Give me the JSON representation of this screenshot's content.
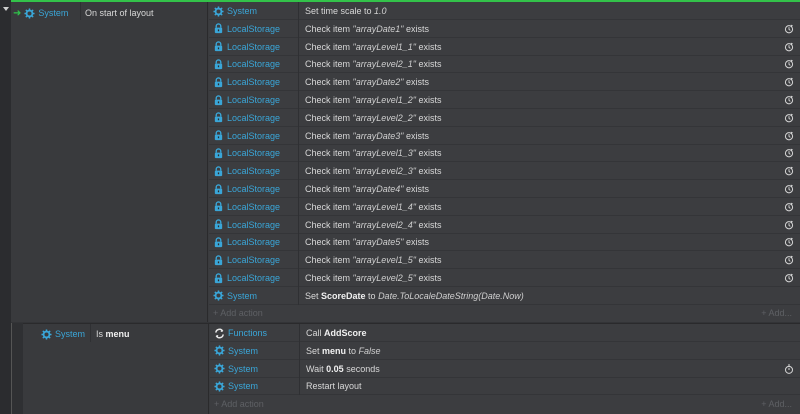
{
  "colors": {
    "link": "#3aa6d8",
    "start_green": "#33c24a",
    "bg": "#333437"
  },
  "event1": {
    "trigger_icon": "arrow-right-icon",
    "condition": {
      "object": "System",
      "object_icon": "gear-icon",
      "text": "On start of layout"
    },
    "actions": [
      {
        "object": "System",
        "icon": "gear-icon",
        "parts": [
          "Set time scale to ",
          {
            "i": "1.0"
          }
        ]
      },
      {
        "object": "LocalStorage",
        "icon": "lock-icon",
        "parts": [
          "Check item ",
          {
            "i": "\"arrayDate1\""
          },
          " exists"
        ],
        "async": true
      },
      {
        "object": "LocalStorage",
        "icon": "lock-icon",
        "parts": [
          "Check item ",
          {
            "i": "\"arrayLevel1_1\""
          },
          " exists"
        ],
        "async": true
      },
      {
        "object": "LocalStorage",
        "icon": "lock-icon",
        "parts": [
          "Check item ",
          {
            "i": "\"arrayLevel2_1\""
          },
          " exists"
        ],
        "async": true
      },
      {
        "object": "LocalStorage",
        "icon": "lock-icon",
        "parts": [
          "Check item ",
          {
            "i": "\"arrayDate2\""
          },
          " exists"
        ],
        "async": true
      },
      {
        "object": "LocalStorage",
        "icon": "lock-icon",
        "parts": [
          "Check item ",
          {
            "i": "\"arrayLevel1_2\""
          },
          " exists"
        ],
        "async": true
      },
      {
        "object": "LocalStorage",
        "icon": "lock-icon",
        "parts": [
          "Check item ",
          {
            "i": "\"arrayLevel2_2\""
          },
          " exists"
        ],
        "async": true
      },
      {
        "object": "LocalStorage",
        "icon": "lock-icon",
        "parts": [
          "Check item ",
          {
            "i": "\"arrayDate3\""
          },
          " exists"
        ],
        "async": true
      },
      {
        "object": "LocalStorage",
        "icon": "lock-icon",
        "parts": [
          "Check item ",
          {
            "i": "\"arrayLevel1_3\""
          },
          " exists"
        ],
        "async": true
      },
      {
        "object": "LocalStorage",
        "icon": "lock-icon",
        "parts": [
          "Check item ",
          {
            "i": "\"arrayLevel2_3\""
          },
          " exists"
        ],
        "async": true
      },
      {
        "object": "LocalStorage",
        "icon": "lock-icon",
        "parts": [
          "Check item ",
          {
            "i": "\"arrayDate4\""
          },
          " exists"
        ],
        "async": true
      },
      {
        "object": "LocalStorage",
        "icon": "lock-icon",
        "parts": [
          "Check item ",
          {
            "i": "\"arrayLevel1_4\""
          },
          " exists"
        ],
        "async": true
      },
      {
        "object": "LocalStorage",
        "icon": "lock-icon",
        "parts": [
          "Check item ",
          {
            "i": "\"arrayLevel2_4\""
          },
          " exists"
        ],
        "async": true
      },
      {
        "object": "LocalStorage",
        "icon": "lock-icon",
        "parts": [
          "Check item ",
          {
            "i": "\"arrayDate5\""
          },
          " exists"
        ],
        "async": true
      },
      {
        "object": "LocalStorage",
        "icon": "lock-icon",
        "parts": [
          "Check item ",
          {
            "i": "\"arrayLevel1_5\""
          },
          " exists"
        ],
        "async": true
      },
      {
        "object": "LocalStorage",
        "icon": "lock-icon",
        "parts": [
          "Check item ",
          {
            "i": "\"arrayLevel2_5\""
          },
          " exists"
        ],
        "async": true
      },
      {
        "object": "System",
        "icon": "gear-icon",
        "parts": [
          "Set ",
          {
            "b": "ScoreDate"
          },
          " to ",
          {
            "i": "Date.ToLocaleDateString(Date.Now)"
          }
        ]
      }
    ],
    "add_action_left": "+ Add action",
    "add_action_right": "+ Add..."
  },
  "event2": {
    "condition": {
      "object": "System",
      "object_icon": "gear-icon",
      "text_prefix": "Is ",
      "text_bold": "menu"
    },
    "actions": [
      {
        "object": "Functions",
        "icon": "functions-icon",
        "parts": [
          "Call ",
          {
            "b": "AddScore"
          }
        ]
      },
      {
        "object": "System",
        "icon": "gear-icon",
        "parts": [
          "Set ",
          {
            "b": "menu"
          },
          " to ",
          {
            "i": "False"
          }
        ]
      },
      {
        "object": "System",
        "icon": "gear-icon",
        "parts": [
          "Wait ",
          {
            "b": "0.05"
          },
          " seconds"
        ],
        "wait": true
      },
      {
        "object": "System",
        "icon": "gear-icon",
        "parts": [
          "Restart layout"
        ]
      }
    ],
    "add_action_left": "+ Add action",
    "add_action_right": "+ Add..."
  }
}
